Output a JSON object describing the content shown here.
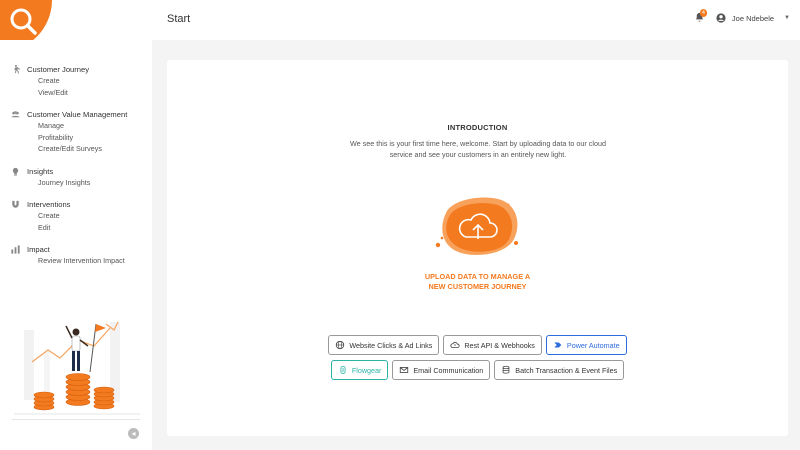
{
  "header": {
    "page_title": "Start",
    "notifications_count": "4",
    "user_name": "Joe Ndebele"
  },
  "sidebar": {
    "groups": [
      {
        "label": "Customer Journey",
        "icon": "walking-person-icon",
        "items": [
          "Create",
          "View/Edit"
        ]
      },
      {
        "label": "Customer Value Management",
        "icon": "users-icon",
        "items": [
          "Manage",
          "Profitability",
          "Create/Edit Surveys"
        ]
      },
      {
        "label": "Insights",
        "icon": "lightbulb-icon",
        "items": [
          "Journey Insights"
        ]
      },
      {
        "label": "Interventions",
        "icon": "magnet-icon",
        "items": [
          "Create",
          "Edit"
        ]
      },
      {
        "label": "Impact",
        "icon": "bar-chart-icon",
        "items": [
          "Review Intervention Impact"
        ]
      }
    ]
  },
  "main": {
    "intro_title": "INTRODUCTION",
    "intro_text": "We see this is your first time here, welcome. Start by uploading data to our cloud service and see your customers in an entirely new light.",
    "upload_line1": "UPLOAD DATA TO MANAGE A",
    "upload_line2": "NEW CUSTOMER JOURNEY",
    "sources_row1": [
      {
        "label": "Website Clicks & Ad Links",
        "icon": "globe-icon"
      },
      {
        "label": "Rest API & Webhooks",
        "icon": "cloud-sync-icon"
      },
      {
        "label": "Power Automate",
        "icon": "power-automate-icon"
      }
    ],
    "sources_row2": [
      {
        "label": "Flowgear",
        "icon": "flowgear-icon"
      },
      {
        "label": "Email Communication",
        "icon": "envelope-icon"
      },
      {
        "label": "Batch Transaction & Event Files",
        "icon": "file-stack-icon"
      }
    ]
  },
  "colors": {
    "brand": "#f47a20",
    "power_automate": "#2d6cdf",
    "flowgear": "#2cb3a6"
  }
}
